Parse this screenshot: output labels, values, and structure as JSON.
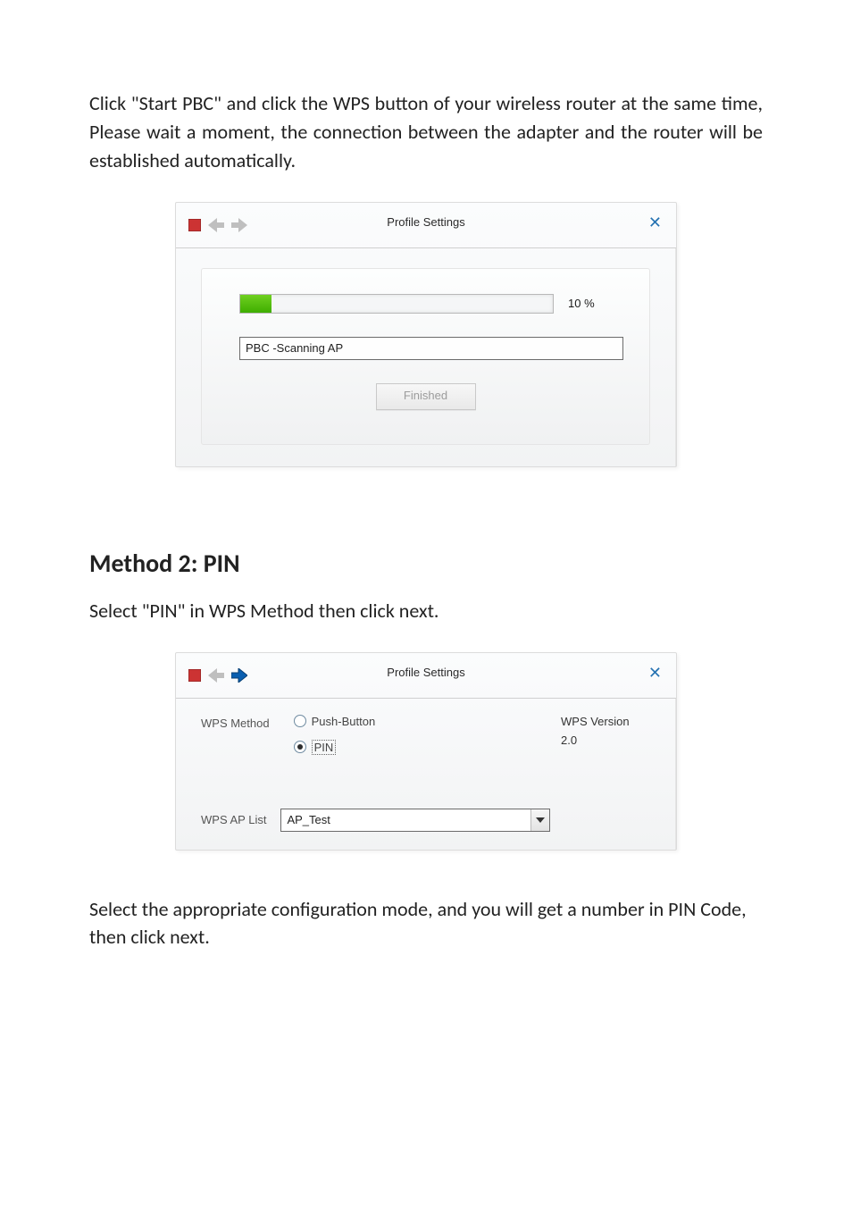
{
  "para1": "Click \"Start PBC\" and click the WPS button of your wireless router at the same time, Please wait a moment, the connection between the adapter and the router will be established automatically.",
  "heading_method2": "Method 2: PIN",
  "para2": "Select \"PIN\" in WPS Method then click next.",
  "para3": "Select the appropriate configuration mode, and you will get a number in PIN Code, then click next.",
  "dialog1": {
    "title": "Profile Settings",
    "progress_percent": 10,
    "progress_label": "10 %",
    "status_text": "PBC -Scanning AP",
    "finish_label": "Finished"
  },
  "dialog2": {
    "title": "Profile Settings",
    "wps_method_label": "WPS Method",
    "opt_push": "Push-Button",
    "opt_pin": "PIN",
    "wps_version_label": "WPS Version",
    "wps_version_value": "2.0",
    "aplist_label": "WPS AP List",
    "aplist_value": "AP_Test"
  }
}
